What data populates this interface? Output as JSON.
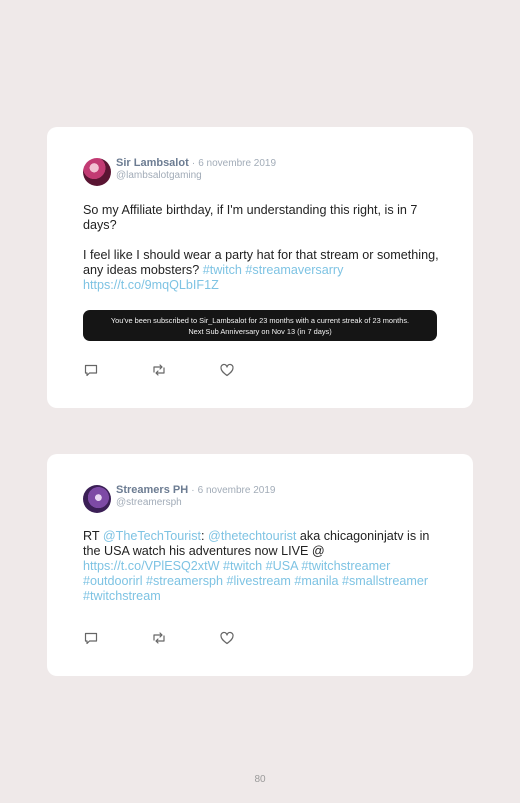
{
  "tweets": [
    {
      "display_name": "Sir Lambsalot",
      "dot": "·",
      "date": "6 novembre 2019",
      "handle": "@lambsalotgaming",
      "text_line1": "So my Affiliate birthday, if I'm understanding this right, is in 7 days?",
      "text_line2_plain": "I feel like I should wear a party hat for that stream or something, any ideas mobsters? ",
      "hashtag1": "#twitch",
      "hashtag2": "#streamaversarry",
      "url": "https://t.co/9mqQLbIF1Z",
      "sub_banner": {
        "line1": "You've been subscribed to Sir_Lambsalot for 23 months with a current streak of 23 months.",
        "line2": "Next Sub Anniversary on Nov 13 (in 7 days)"
      }
    },
    {
      "display_name": "Streamers PH",
      "dot": "·",
      "date": "6 novembre 2019",
      "handle": "@streamersph",
      "rt": "RT ",
      "mention1": "@TheTechTourist",
      "colon": ": ",
      "mention2": "@thetechtourist",
      "text_mid": " aka chicagoninjatv is in the USA watch his adventures now LIVE @ ",
      "url": "https://t.co/VPlESQ2xtW",
      "hashtags": "#twitch #USA #twitchstreamer #outdoorirl #streamersph #livestream #manila #smallstreamer #twitchstream"
    }
  ],
  "icons": [
    "reply-icon",
    "retweet-icon",
    "like-icon"
  ],
  "page_number": "80"
}
